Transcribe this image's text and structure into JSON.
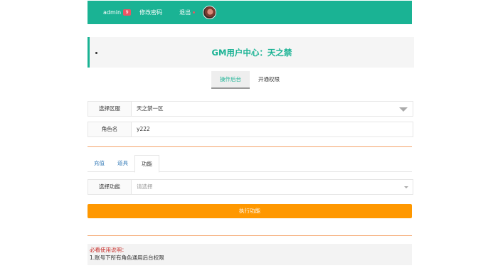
{
  "topbar": {
    "username": "admin",
    "badge_count": "9",
    "change_password": "修改密码",
    "logout": "退出"
  },
  "title": "GM用户中心：天之禁",
  "main_tabs": [
    "操作后台",
    "开通权限"
  ],
  "server_row": {
    "label": "选择区服",
    "value": "天之禁一区"
  },
  "role_row": {
    "label": "角色名",
    "value": "y222"
  },
  "sub_tabs": [
    "充值",
    "道具",
    "功能"
  ],
  "function_row": {
    "label": "选择功能",
    "placeholder": "请选择"
  },
  "execute_button": "执行功能",
  "notes": {
    "title": "必看使用说明：",
    "lines": [
      "1.账号下所有角色通用后台权限"
    ]
  },
  "colors": {
    "accent": "#1ab394",
    "orange": "#ff9800",
    "badge": "#ed5565"
  }
}
